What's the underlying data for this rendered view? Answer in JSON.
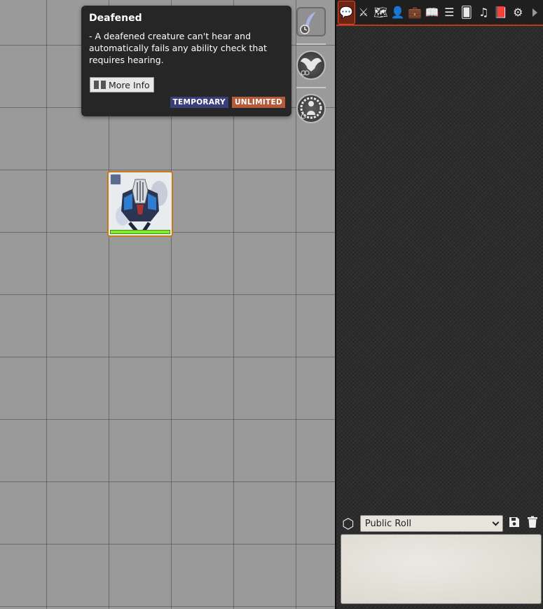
{
  "tooltip": {
    "title": "Deafened",
    "description": "- A deafened creature can't hear and automatically fails any ability check that requires hearing.",
    "more_info_label": "More Info",
    "badges": {
      "temporary": "TEMPORARY",
      "unlimited": "UNLIMITED"
    }
  },
  "effect_icons": [
    "deafened-effect-icon",
    "wings-effect-icon",
    "figure-aura-effect-icon"
  ],
  "token": {
    "name": "armored-creature-token",
    "hp_fraction": 1.0
  },
  "sidebar": {
    "tabs": [
      {
        "name": "chat",
        "glyph": "💬"
      },
      {
        "name": "combat",
        "glyph": "⚔"
      },
      {
        "name": "scenes",
        "glyph": "🗺"
      },
      {
        "name": "actors",
        "glyph": "👤"
      },
      {
        "name": "items",
        "glyph": "💼"
      },
      {
        "name": "journal",
        "glyph": "📖"
      },
      {
        "name": "tables",
        "glyph": "☰"
      },
      {
        "name": "cards",
        "glyph": "🂠"
      },
      {
        "name": "playlists",
        "glyph": "♫"
      },
      {
        "name": "compendium",
        "glyph": "📕"
      },
      {
        "name": "settings",
        "glyph": "⚙"
      }
    ],
    "roll_mode": "Public Roll"
  },
  "colors": {
    "accent": "#b83b1d",
    "badge_temporary": "#3a3f7a",
    "badge_unlimited": "#b55a3b",
    "hp_bar": "#7cf02a"
  }
}
